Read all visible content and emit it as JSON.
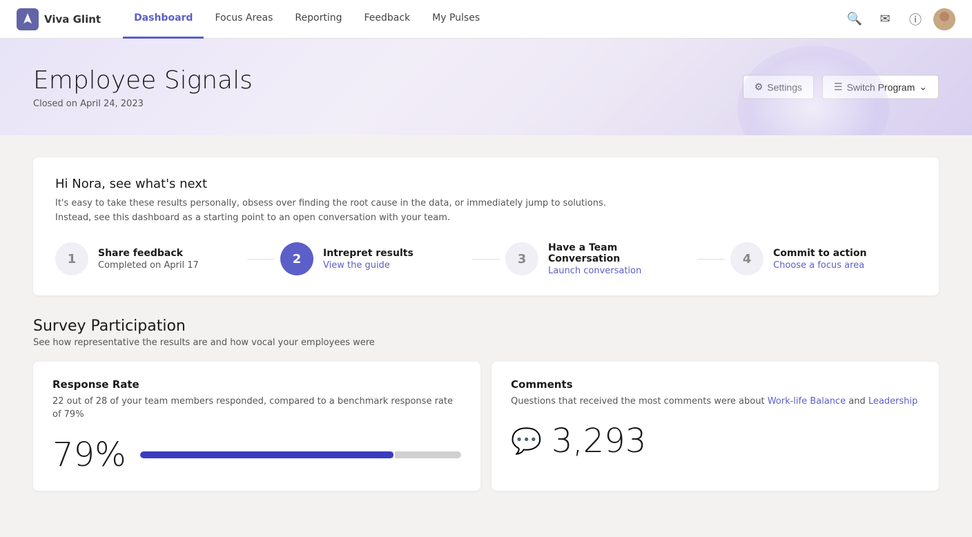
{
  "nav": {
    "brand_name": "Viva Glint",
    "links": [
      {
        "label": "Dashboard",
        "active": true
      },
      {
        "label": "Focus Areas",
        "active": false
      },
      {
        "label": "Reporting",
        "active": false
      },
      {
        "label": "Feedback",
        "active": false
      },
      {
        "label": "My Pulses",
        "active": false
      }
    ]
  },
  "hero": {
    "title": "Employee Signals",
    "subtitle": "Closed on April 24, 2023",
    "settings_label": "Settings",
    "switch_program_label": "Switch Program"
  },
  "whats_next": {
    "heading": "Hi Nora, see what's next",
    "description_line1": "It's easy to take these results personally, obsess over finding the root cause in the data, or immediately jump to solutions.",
    "description_line2": "Instead, see this dashboard as a starting point to an open conversation with your team.",
    "steps": [
      {
        "number": "1",
        "name": "Share feedback",
        "sub": "Completed on April 17",
        "link": null,
        "state": "inactive"
      },
      {
        "number": "2",
        "name": "Intrepret results",
        "sub": "View the guide",
        "link": "#",
        "state": "active"
      },
      {
        "number": "3",
        "name": "Have a Team Conversation",
        "sub": "Launch conversation",
        "link": "#",
        "state": "inactive"
      },
      {
        "number": "4",
        "name": "Commit to action",
        "sub": "Choose a focus area",
        "link": "#",
        "state": "inactive"
      }
    ]
  },
  "participation": {
    "heading": "Survey Participation",
    "description": "See how representative the results are and how vocal your employees were",
    "response_rate": {
      "title": "Response Rate",
      "description": "22 out of 28 of your team members responded, compared to a benchmark response rate of 79%",
      "value": "79%",
      "progress_pct": 79,
      "benchmark_pct": 79
    },
    "comments": {
      "title": "Comments",
      "description_prefix": "Questions that received the most comments were about ",
      "link1_label": "Work-life Balance",
      "link1_href": "#",
      "description_and": " and ",
      "link2_label": "Leadership",
      "link2_href": "#",
      "count": "3,293"
    }
  }
}
